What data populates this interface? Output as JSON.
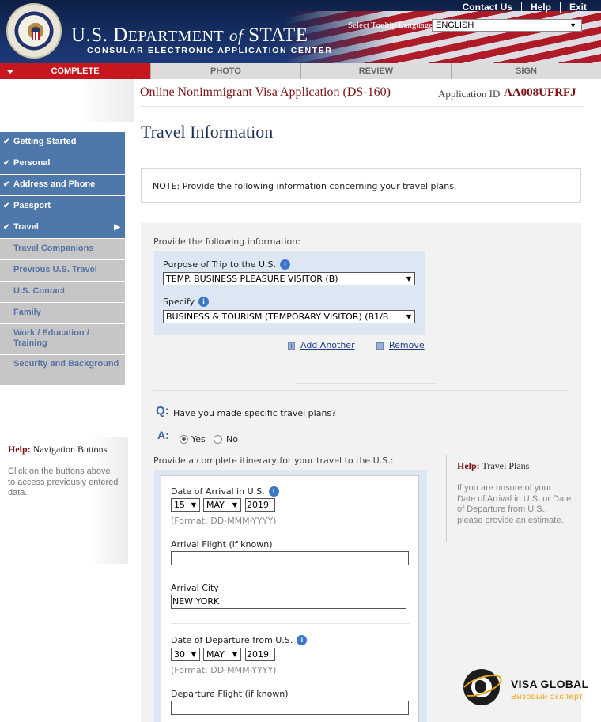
{
  "header": {
    "dept_line1": "U.S. D",
    "dept_line1_rest": "EPARTMENT",
    "dept_of": "of",
    "dept_state": "STATE",
    "subtitle": "CONSULAR ELECTRONIC APPLICATION CENTER",
    "links": [
      "Contact Us",
      "Help",
      "Exit"
    ],
    "tooltip_label": "Select Tooltip Language",
    "tooltip_value": "ENGLISH"
  },
  "tabs": [
    {
      "label": "COMPLETE",
      "active": true
    },
    {
      "label": "PHOTO",
      "active": false
    },
    {
      "label": "REVIEW",
      "active": false
    },
    {
      "label": "SIGN",
      "active": false
    }
  ],
  "app": {
    "title": "Online Nonimmigrant Visa Application (DS-160)",
    "id_label": "Application ID",
    "id_value": "AA008UFRFJ"
  },
  "sidebar": {
    "done_items": [
      "Getting Started",
      "Personal",
      "Address and Phone",
      "Passport",
      "Travel"
    ],
    "sub_items": [
      "Travel Companions",
      "Previous U.S. Travel",
      "U.S. Contact",
      "Family"
    ],
    "sub_items_tall": [
      "Work / Education / Training",
      "Security and Background"
    ]
  },
  "help_nav": {
    "title_bold": "Help:",
    "title_rest": " Navigation Buttons",
    "text": "Click on the buttons above to access previously entered data."
  },
  "page": {
    "title": "Travel Information",
    "note": "NOTE: Provide the following information concerning your travel plans."
  },
  "form": {
    "provide_label": "Provide the following information:",
    "purpose_label": "Purpose of Trip to the U.S.",
    "purpose_value": "TEMP. BUSINESS PLEASURE VISITOR (B)",
    "specify_label": "Specify",
    "specify_value": "BUSINESS & TOURISM (TEMPORARY VISITOR) (B1/B",
    "add_another": "Add Another",
    "remove": "Remove",
    "q_letter": "Q:",
    "question": "Have you made specific travel plans?",
    "a_letter": "A:",
    "yes": "Yes",
    "no": "No",
    "itin_label": "Provide a complete itinerary for your travel to the U.S.:",
    "arrival_date_label": "Date of Arrival in U.S.",
    "arrival_day": "15",
    "arrival_month": "MAY",
    "arrival_year": "2019",
    "date_format": "(Format: DD-MMM-YYYY)",
    "arrival_flight_label": "Arrival Flight (if known)",
    "arrival_flight_value": "",
    "arrival_city_label": "Arrival City",
    "arrival_city_value": "NEW YORK",
    "departure_date_label": "Date of Departure from U.S.",
    "departure_day": "30",
    "departure_month": "MAY",
    "departure_year": "2019",
    "departure_flight_label": "Departure Flight (if known)",
    "departure_flight_value": ""
  },
  "help_travel": {
    "title_bold": "Help:",
    "title_rest": " Travel Plans",
    "text": "If you are unsure of your Date of Arrival in U.S. or Date of Departure from U.S., please provide an estimate."
  },
  "watermark": {
    "name": "VISA GLOBAL",
    "tagline": "Визовый эксперт"
  },
  "colors": {
    "tab_active": "#c8161e",
    "nav_done": "#4e77aa",
    "nav_sub": "#c6c6c6",
    "title_red": "#7a1416",
    "panel_blue": "#dde7f4"
  },
  "icons": {
    "nav_done": "check-icon",
    "nav_current": "arrow-right-icon",
    "info": "info-icon",
    "add": "plus-icon",
    "remove": "minus-icon"
  }
}
